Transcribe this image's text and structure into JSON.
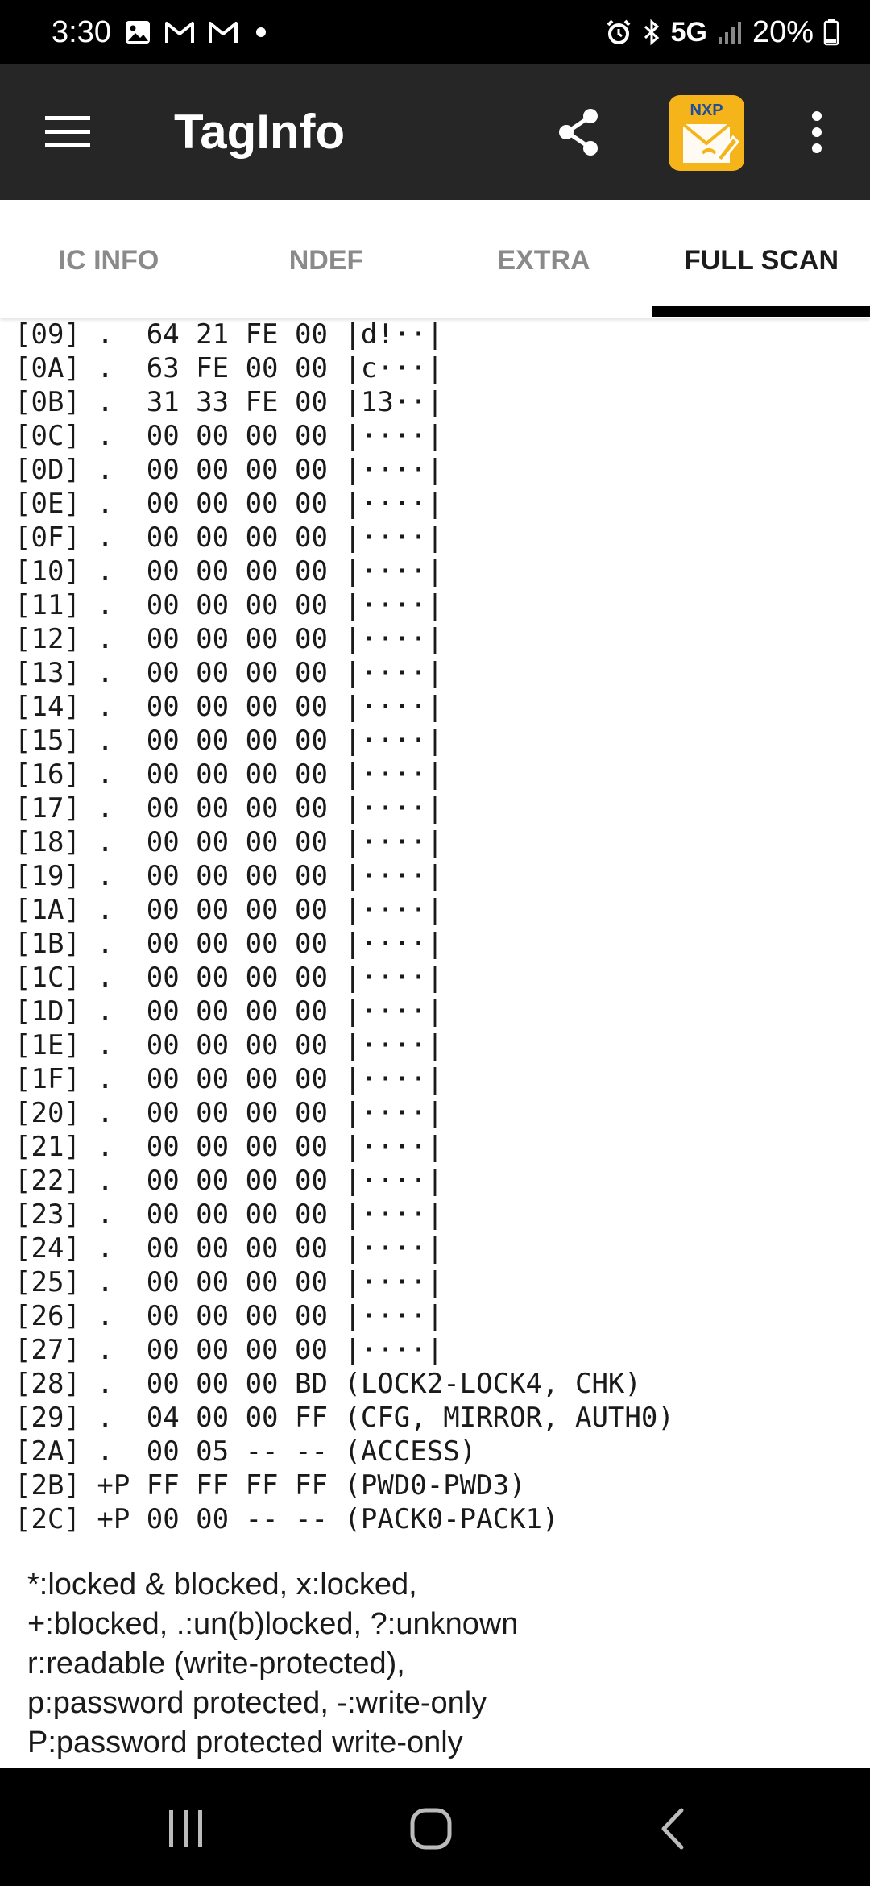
{
  "status_bar": {
    "time": "3:30",
    "left_icons": [
      "gallery-icon",
      "gmail-icon",
      "gmail-icon",
      "dot-icon"
    ],
    "network": "5G",
    "battery": "20%"
  },
  "app_bar": {
    "title": "TagInfo",
    "nxp_logo_text": "NXP"
  },
  "tabs": [
    {
      "label": "IC INFO",
      "active": false
    },
    {
      "label": "NDEF",
      "active": false
    },
    {
      "label": "EXTRA",
      "active": false
    },
    {
      "label": "FULL SCAN",
      "active": true
    }
  ],
  "scan_lines": [
    "[09] .  64 21 FE 00 |d!··|",
    "[0A] .  63 FE 00 00 |c···|",
    "[0B] .  31 33 FE 00 |13··|",
    "[0C] .  00 00 00 00 |····|",
    "[0D] .  00 00 00 00 |····|",
    "[0E] .  00 00 00 00 |····|",
    "[0F] .  00 00 00 00 |····|",
    "[10] .  00 00 00 00 |····|",
    "[11] .  00 00 00 00 |····|",
    "[12] .  00 00 00 00 |····|",
    "[13] .  00 00 00 00 |····|",
    "[14] .  00 00 00 00 |····|",
    "[15] .  00 00 00 00 |····|",
    "[16] .  00 00 00 00 |····|",
    "[17] .  00 00 00 00 |····|",
    "[18] .  00 00 00 00 |····|",
    "[19] .  00 00 00 00 |····|",
    "[1A] .  00 00 00 00 |····|",
    "[1B] .  00 00 00 00 |····|",
    "[1C] .  00 00 00 00 |····|",
    "[1D] .  00 00 00 00 |····|",
    "[1E] .  00 00 00 00 |····|",
    "[1F] .  00 00 00 00 |····|",
    "[20] .  00 00 00 00 |····|",
    "[21] .  00 00 00 00 |····|",
    "[22] .  00 00 00 00 |····|",
    "[23] .  00 00 00 00 |····|",
    "[24] .  00 00 00 00 |····|",
    "[25] .  00 00 00 00 |····|",
    "[26] .  00 00 00 00 |····|",
    "[27] .  00 00 00 00 |····|",
    "[28] .  00 00 00 BD (LOCK2-LOCK4, CHK)",
    "[29] .  04 00 00 FF (CFG, MIRROR, AUTH0)",
    "[2A] .  00 05 -- -- (ACCESS)",
    "[2B] +P FF FF FF FF (PWD0-PWD3)",
    "[2C] +P 00 00 -- -- (PACK0-PACK1)"
  ],
  "legend": [
    "*:locked & blocked, x:locked,",
    "+:blocked, .:un(b)locked, ?:unknown",
    "r:readable (write-protected),",
    "p:password protected, -:write-only",
    "P:password protected write-only"
  ],
  "colors": {
    "status_bar_bg": "#000000",
    "app_bar_bg": "#262626",
    "nxp_badge_bg": "#f4b41a",
    "tab_active": "#1c1c1c",
    "tab_inactive": "#8a8a8a",
    "nav_bar_bg": "#000000"
  }
}
